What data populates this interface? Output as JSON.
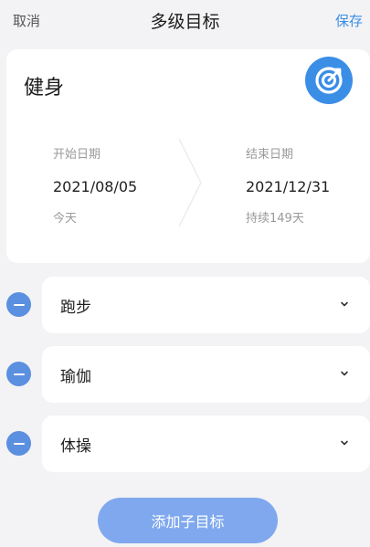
{
  "colors": {
    "accent": "#3a8ee6",
    "remove_blue": "#5b8fe0",
    "add_button": "#7fa8ee"
  },
  "header": {
    "cancel_label": "取消",
    "title": "多级目标",
    "save_label": "保存"
  },
  "goal": {
    "name": "健身",
    "icon": "target-icon",
    "start": {
      "label": "开始日期",
      "date": "2021/08/05",
      "note": "今天"
    },
    "end": {
      "label": "结束日期",
      "date": "2021/12/31",
      "note": "持续149天"
    }
  },
  "sub_goals": [
    {
      "label": "跑步"
    },
    {
      "label": "瑜伽"
    },
    {
      "label": "体操"
    }
  ],
  "add_button_label": "添加子目标"
}
